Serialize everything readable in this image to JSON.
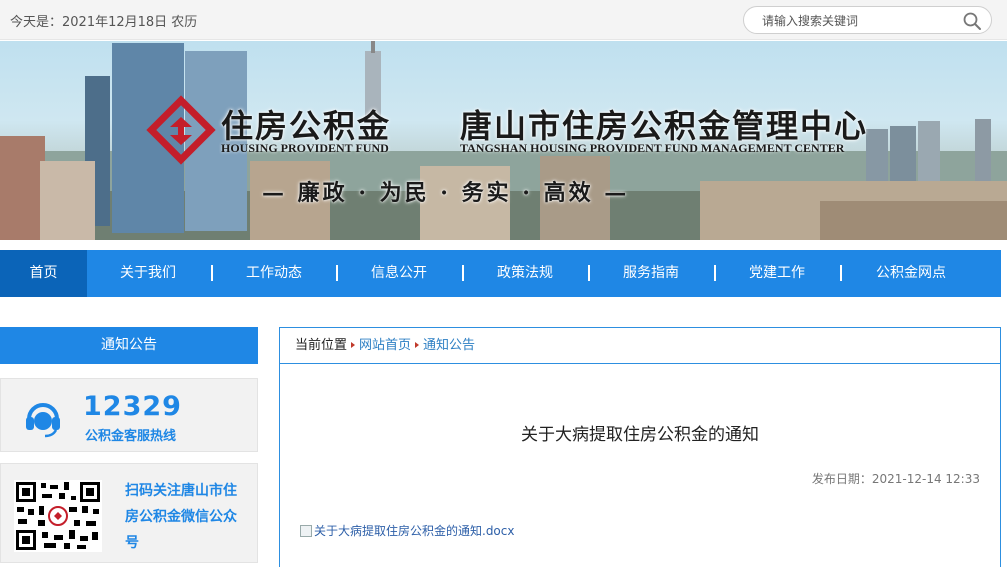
{
  "topbar": {
    "date_text": "今天是：2021年12月18日 农历",
    "search_placeholder": "请输入搜索关键词"
  },
  "banner": {
    "brand_cn": "住房公积金",
    "brand_en": "HOUSING PROVIDENT FUND",
    "center_cn": "唐山市住房公积金管理中心",
    "center_en": "TANGSHAN HOUSING PROVIDENT FUND MANAGEMENT CENTER",
    "slogan": "— 廉政 · 为民 · 务实 · 高效 —",
    "logo_color": "#c41e2a"
  },
  "nav": {
    "items": [
      {
        "label": "首页"
      },
      {
        "label": "关于我们"
      },
      {
        "label": "工作动态"
      },
      {
        "label": "信息公开"
      },
      {
        "label": "政策法规"
      },
      {
        "label": "服务指南"
      },
      {
        "label": "党建工作"
      },
      {
        "label": "公积金网点"
      }
    ],
    "active": "首页"
  },
  "sidebar": {
    "title": "通知公告",
    "hotline_number": "12329",
    "hotline_label": "公积金客服热线",
    "qr_text": "扫码关注唐山市住房公积金微信公众号"
  },
  "breadcrumb": {
    "prefix": "当前位置",
    "home": "网站首页",
    "current": "通知公告"
  },
  "article": {
    "title": "关于大病提取住房公积金的通知",
    "publish": "发布日期：2021-12-14 12:33",
    "attachment": "关于大病提取住房公积金的通知.docx"
  },
  "colors": {
    "accent": "#1f87e5",
    "nav_active": "#0b64b8",
    "border": "#2d8fe0",
    "link": "#2d7fc4"
  }
}
